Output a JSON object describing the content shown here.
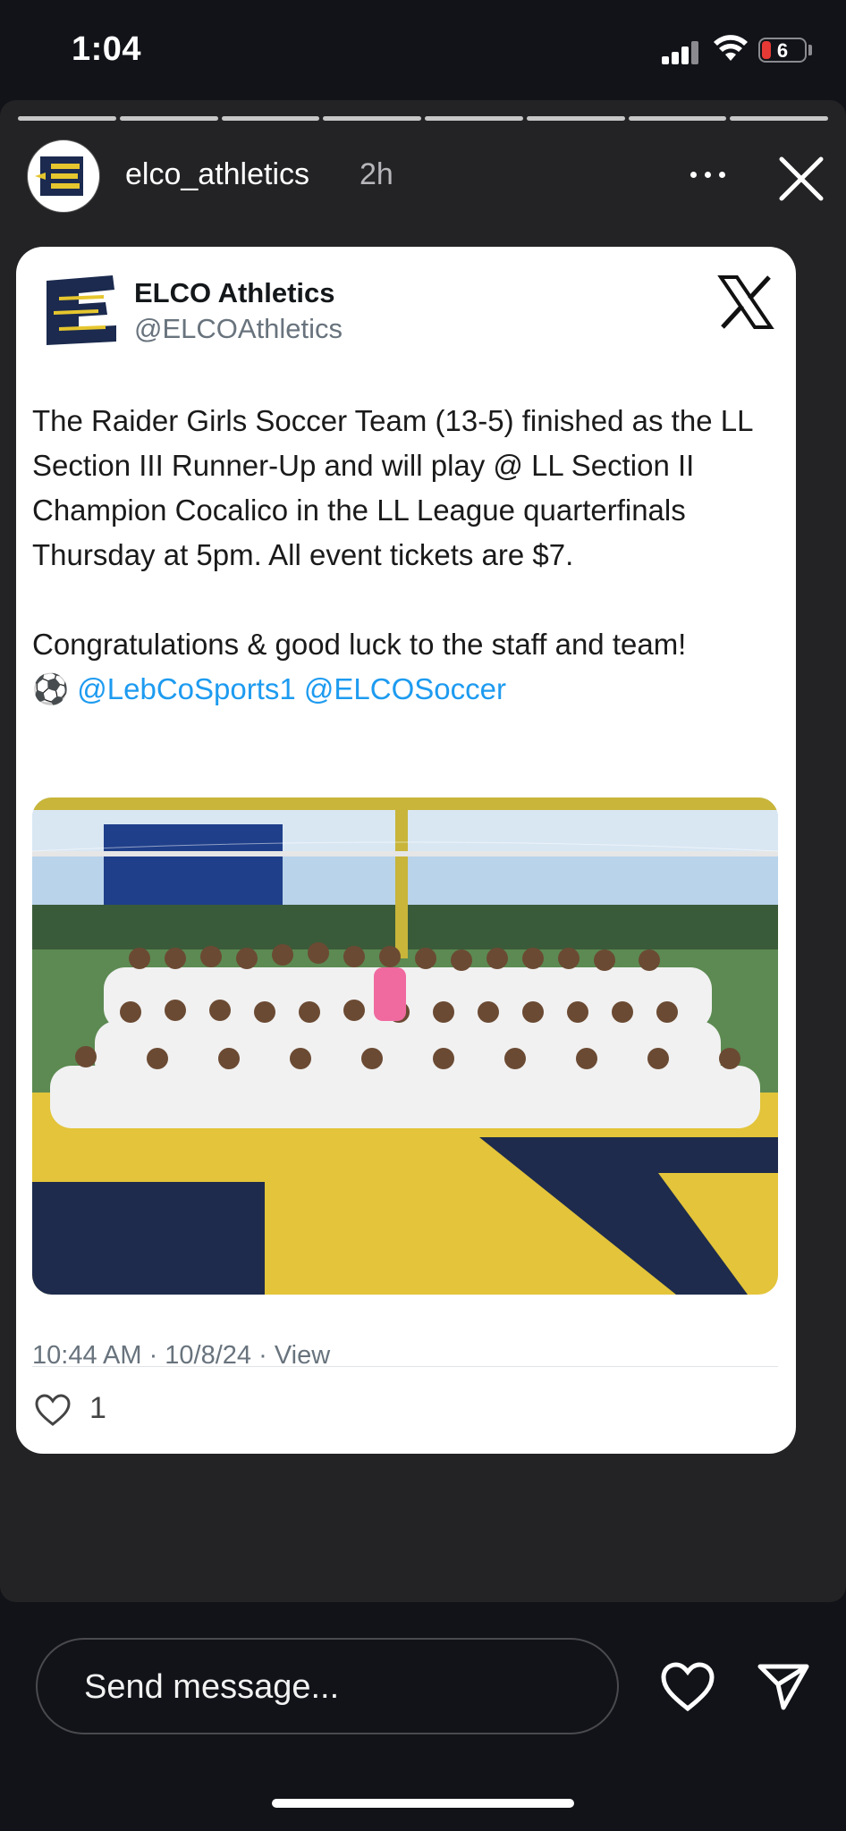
{
  "status_bar": {
    "time": "1:04",
    "battery": "6"
  },
  "story": {
    "username": "elco_athletics",
    "time_ago": "2h",
    "segments": 8,
    "more_icon": "more-icon",
    "close_icon": "close-icon"
  },
  "tweet": {
    "display_name": "ELCO Athletics",
    "handle": "@ELCOAthletics",
    "paragraph1": "The Raider Girls Soccer Team (13-5) finished as the LL Section III Runner-Up and will play @ LL Section II Champion Cocalico in the LL League quarterfinals Thursday at 5pm. All event tickets are $7.",
    "paragraph2": "Congratulations & good luck to the staff and team!",
    "emoji": "⚽",
    "mention1": "@LebCoSports1",
    "mention2": "@ELCOSoccer",
    "timestamp": "10:44 AM · 10/8/24 · View",
    "likes": "1"
  },
  "message_bar": {
    "placeholder": "Send message..."
  },
  "colors": {
    "background": "#111318",
    "story_bg": "#232325",
    "link": "#1d9bf0",
    "navy": "#1b2a4e",
    "gold": "#e6c62e"
  }
}
